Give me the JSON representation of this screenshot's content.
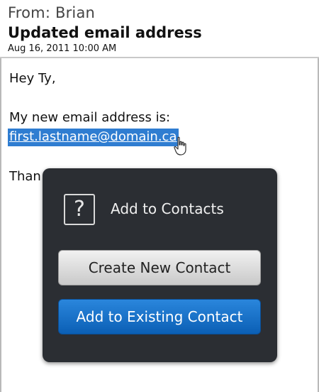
{
  "header": {
    "from": "From: Brian",
    "subject": "Updated email address",
    "date": "Aug 16, 2011 10:00 AM"
  },
  "message": {
    "greeting": "Hey Ty,",
    "line1": "My new email address is:",
    "email_link": "first.lastname@domain.ca",
    "closing_visible": "Than"
  },
  "popup": {
    "icon": "?",
    "title": "Add to Contacts",
    "create_button": "Create New Contact",
    "existing_button": "Add to Existing Contact"
  },
  "colors": {
    "link_highlight": "#2f7dd1",
    "popup_bg": "#2b2e33",
    "primary_button": "#1a73cc"
  },
  "icons": {
    "question": "question-mark-icon",
    "cursor": "hand-cursor-icon"
  }
}
